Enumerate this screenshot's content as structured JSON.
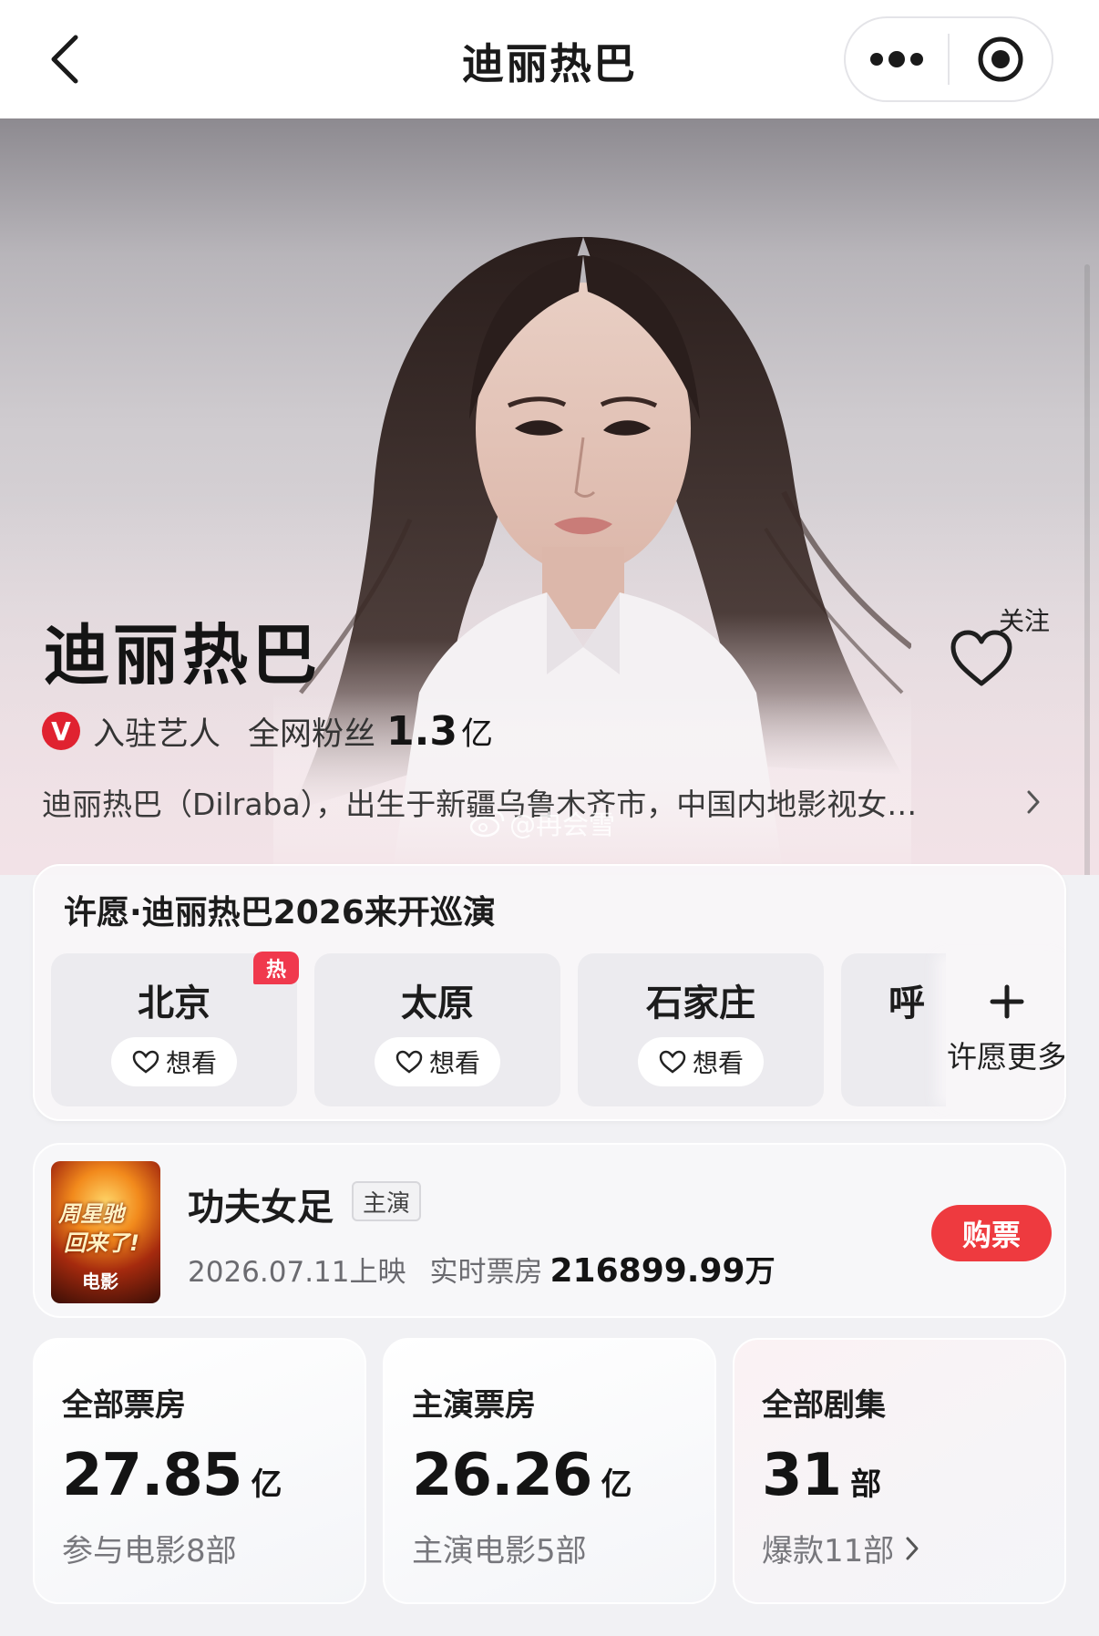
{
  "nav": {
    "title": "迪丽热巴"
  },
  "hero": {
    "name": "迪丽热巴",
    "follow_label": "关注",
    "verified_badge": "V",
    "verified_text": "入驻艺人",
    "fans_label": "全网粉丝",
    "fans_value": "1.3",
    "fans_unit": "亿",
    "bio": "迪丽热巴（Dilraba），出生于新疆乌鲁木齐市，中国内地影视女…",
    "watermark": "@冉会雪"
  },
  "wish": {
    "title": "许愿·迪丽热巴2026来开巡演",
    "hot_tag": "热",
    "want_label": "想看",
    "cities": [
      {
        "name": "北京",
        "hot": true
      },
      {
        "name": "太原",
        "hot": false
      },
      {
        "name": "石家庄",
        "hot": false
      },
      {
        "name": "呼",
        "hot": false
      }
    ],
    "more_label": "许愿更多"
  },
  "movie": {
    "poster_line1": "周星驰",
    "poster_line2": "回来了!",
    "poster_line3": "电影",
    "title": "功夫女足",
    "role_tag": "主演",
    "release": "2026.07.11上映",
    "box_label": "实时票房",
    "box_value": "216899.99",
    "box_unit": "万",
    "buy_label": "购票"
  },
  "stats": [
    {
      "label": "全部票房",
      "value": "27.85",
      "unit": "亿",
      "sub": "参与电影8部",
      "arrow": false
    },
    {
      "label": "主演票房",
      "value": "26.26",
      "unit": "亿",
      "sub": "主演电影5部",
      "arrow": false
    },
    {
      "label": "全部剧集",
      "value": "31",
      "unit": "部",
      "sub": "爆款11部",
      "arrow": true
    }
  ],
  "colors": {
    "accent_red": "#ee3a3f",
    "hot_tag": "#f0394d",
    "verified_red": "#e02230"
  },
  "icons": {
    "back": "chevron-left-icon",
    "more": "more-dots-icon",
    "close": "target-icon",
    "follow": "heart-icon",
    "bio_arrow": "chevron-right-icon",
    "want": "heart-icon",
    "more_wish": "plus-icon"
  }
}
